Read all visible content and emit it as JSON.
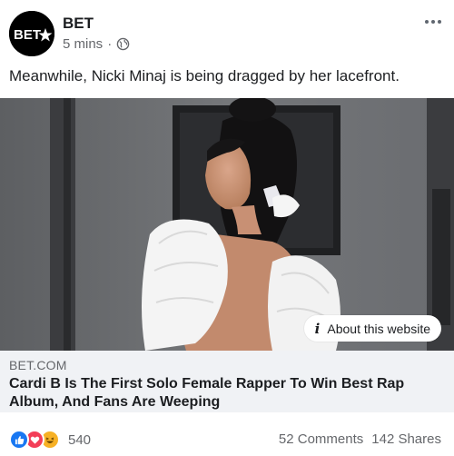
{
  "post": {
    "page_name": "BET",
    "avatar_text": "BET★",
    "time": "5 mins",
    "separator": "·",
    "audience_icon": "globe-icon",
    "more_icon": "ellipsis-icon",
    "caption": "Meanwhile, Nicki Minaj is being dragged by her lacefront."
  },
  "link_preview": {
    "about_label": "About this website",
    "info_icon": "info-icon",
    "domain": "BET.COM",
    "headline": "Cardi B Is The First Solo Female Rapper To Win Best Rap Album, And Fans Are Weeping"
  },
  "engagement": {
    "reaction_icons": [
      "like-icon",
      "love-icon",
      "haha-icon"
    ],
    "reaction_count": "540",
    "comments": "52 Comments",
    "shares": "142 Shares"
  },
  "colors": {
    "facebook_blue": "#1877f2",
    "love_red": "#f33e58",
    "haha_yellow": "#f7b125",
    "secondary_text": "#65676b",
    "link_bg": "#f0f2f5"
  }
}
